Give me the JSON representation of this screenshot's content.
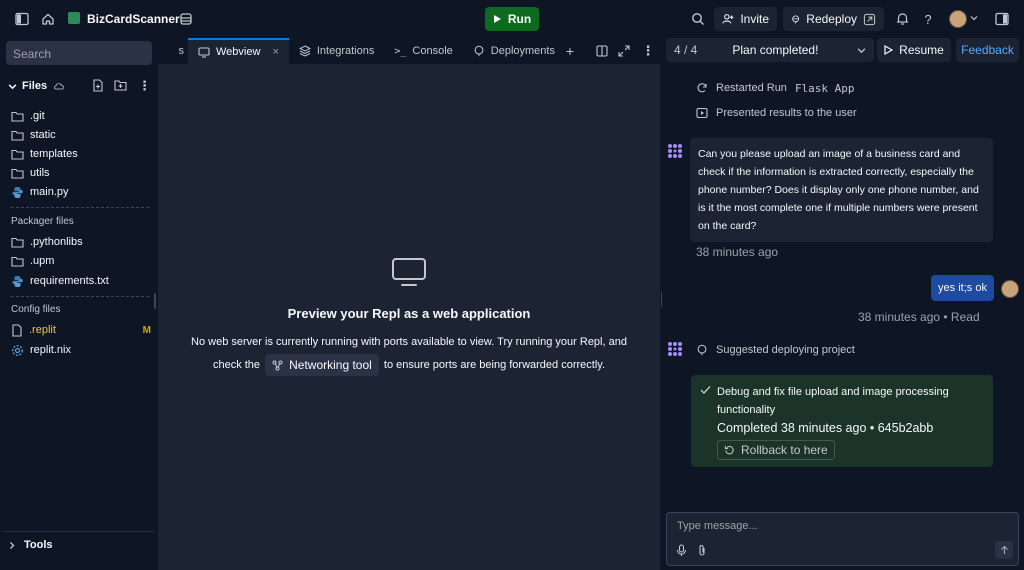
{
  "topbar": {
    "app_name": "BizCardScanner",
    "run_label": "Run",
    "invite_label": "Invite",
    "redeploy_label": "Redeploy"
  },
  "sidebar": {
    "search_placeholder": "Search",
    "files_label": "Files",
    "files": [
      {
        "name": ".git",
        "icon": "folder-icon"
      },
      {
        "name": "static",
        "icon": "folder-icon"
      },
      {
        "name": "templates",
        "icon": "folder-icon"
      },
      {
        "name": "utils",
        "icon": "folder-icon"
      },
      {
        "name": "main.py",
        "icon": "python-icon"
      }
    ],
    "packager_label": "Packager files",
    "packager_files": [
      {
        "name": ".pythonlibs",
        "icon": "folder-icon"
      },
      {
        "name": ".upm",
        "icon": "folder-icon"
      },
      {
        "name": "requirements.txt",
        "icon": "python-icon"
      }
    ],
    "config_label": "Config files",
    "config_files": [
      {
        "name": ".replit",
        "icon": "file-icon",
        "badge": "M"
      },
      {
        "name": "replit.nix",
        "icon": "gear-icon",
        "badge": ""
      }
    ],
    "tools_label": "Tools"
  },
  "tabs": [
    {
      "label": "s",
      "active": false
    },
    {
      "label": "Webview",
      "active": true
    },
    {
      "label": "Integrations",
      "active": false
    },
    {
      "label": "Console",
      "active": false
    },
    {
      "label": "Deployments",
      "active": false
    }
  ],
  "preview": {
    "title": "Preview your Repl as a web application",
    "line1": "No web server is currently running with ports available to view. Try running your Repl, and",
    "line2_pre": "check the",
    "network_tool": "Networking tool",
    "line2_post": "to ensure ports are being forwarded correctly."
  },
  "agent": {
    "progress": "4 / 4",
    "plan_status": "Plan completed!",
    "resume_label": "Resume",
    "feedback_label": "Feedback",
    "log_restart_prefix": "Restarted Run",
    "log_restart_target": "Flask App",
    "log_presented": "Presented results to the user",
    "message": "Can you please upload an image of a business card and check if the information is extracted correctly, especially the phone number? Does it display only one phone number, and is it the most complete one if multiple numbers were present on the card?",
    "message_time": "38 minutes ago",
    "user_reply": "yes it;s ok",
    "user_reply_time": "38 minutes ago • Read",
    "suggested_deploy": "Suggested deploying project",
    "checkpoint_title": "Debug and fix file upload and image processing functionality",
    "checkpoint_status": "Completed 38 minutes ago • 645b2abb",
    "rollback_label": "Rollback to here",
    "input_placeholder": "Type message..."
  },
  "colors": {
    "bg": "#0e1525",
    "panel": "#1c2333",
    "run_green": "#0c6b1f",
    "accent_blue": "#0079f2",
    "user_bubble": "#1e4aa0",
    "success_bg": "#1b3328",
    "agent_purple": "#a78bfa"
  }
}
